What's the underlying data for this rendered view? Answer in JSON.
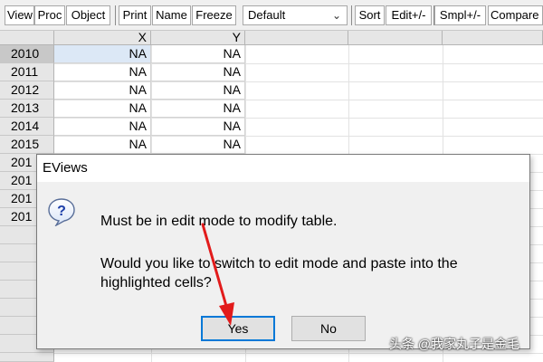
{
  "toolbar": {
    "buttons": [
      "View",
      "Proc",
      "Object",
      "Print",
      "Name",
      "Freeze",
      "Sort",
      "Edit+/-",
      "Smpl+/-",
      "Compare"
    ],
    "display_select": "Default"
  },
  "sheet": {
    "columns": [
      "X",
      "Y"
    ],
    "rows": [
      {
        "label": "2010",
        "x": "NA",
        "y": "NA"
      },
      {
        "label": "2011",
        "x": "NA",
        "y": "NA"
      },
      {
        "label": "2012",
        "x": "NA",
        "y": "NA"
      },
      {
        "label": "2013",
        "x": "NA",
        "y": "NA"
      },
      {
        "label": "2014",
        "x": "NA",
        "y": "NA"
      },
      {
        "label": "2015",
        "x": "NA",
        "y": "NA"
      },
      {
        "label": "201",
        "x": "",
        "y": ""
      },
      {
        "label": "201",
        "x": "",
        "y": ""
      },
      {
        "label": "201",
        "x": "",
        "y": ""
      },
      {
        "label": "201",
        "x": "",
        "y": ""
      }
    ]
  },
  "dialog": {
    "title": "EViews",
    "icon": "question-icon",
    "message_line1": "Must be in edit mode to modify table.",
    "message_line2": "Would you like to switch to edit mode and paste into the highlighted cells?",
    "yes_label": "Yes",
    "no_label": "No"
  },
  "annotation": {
    "arrow_color": "#e21b1b"
  },
  "watermark": "头条 @我家丸子是金毛",
  "colors": {
    "toolbar_bg": "#f0f0f0",
    "highlight": "#dce8f6",
    "focus": "#0078d7"
  }
}
